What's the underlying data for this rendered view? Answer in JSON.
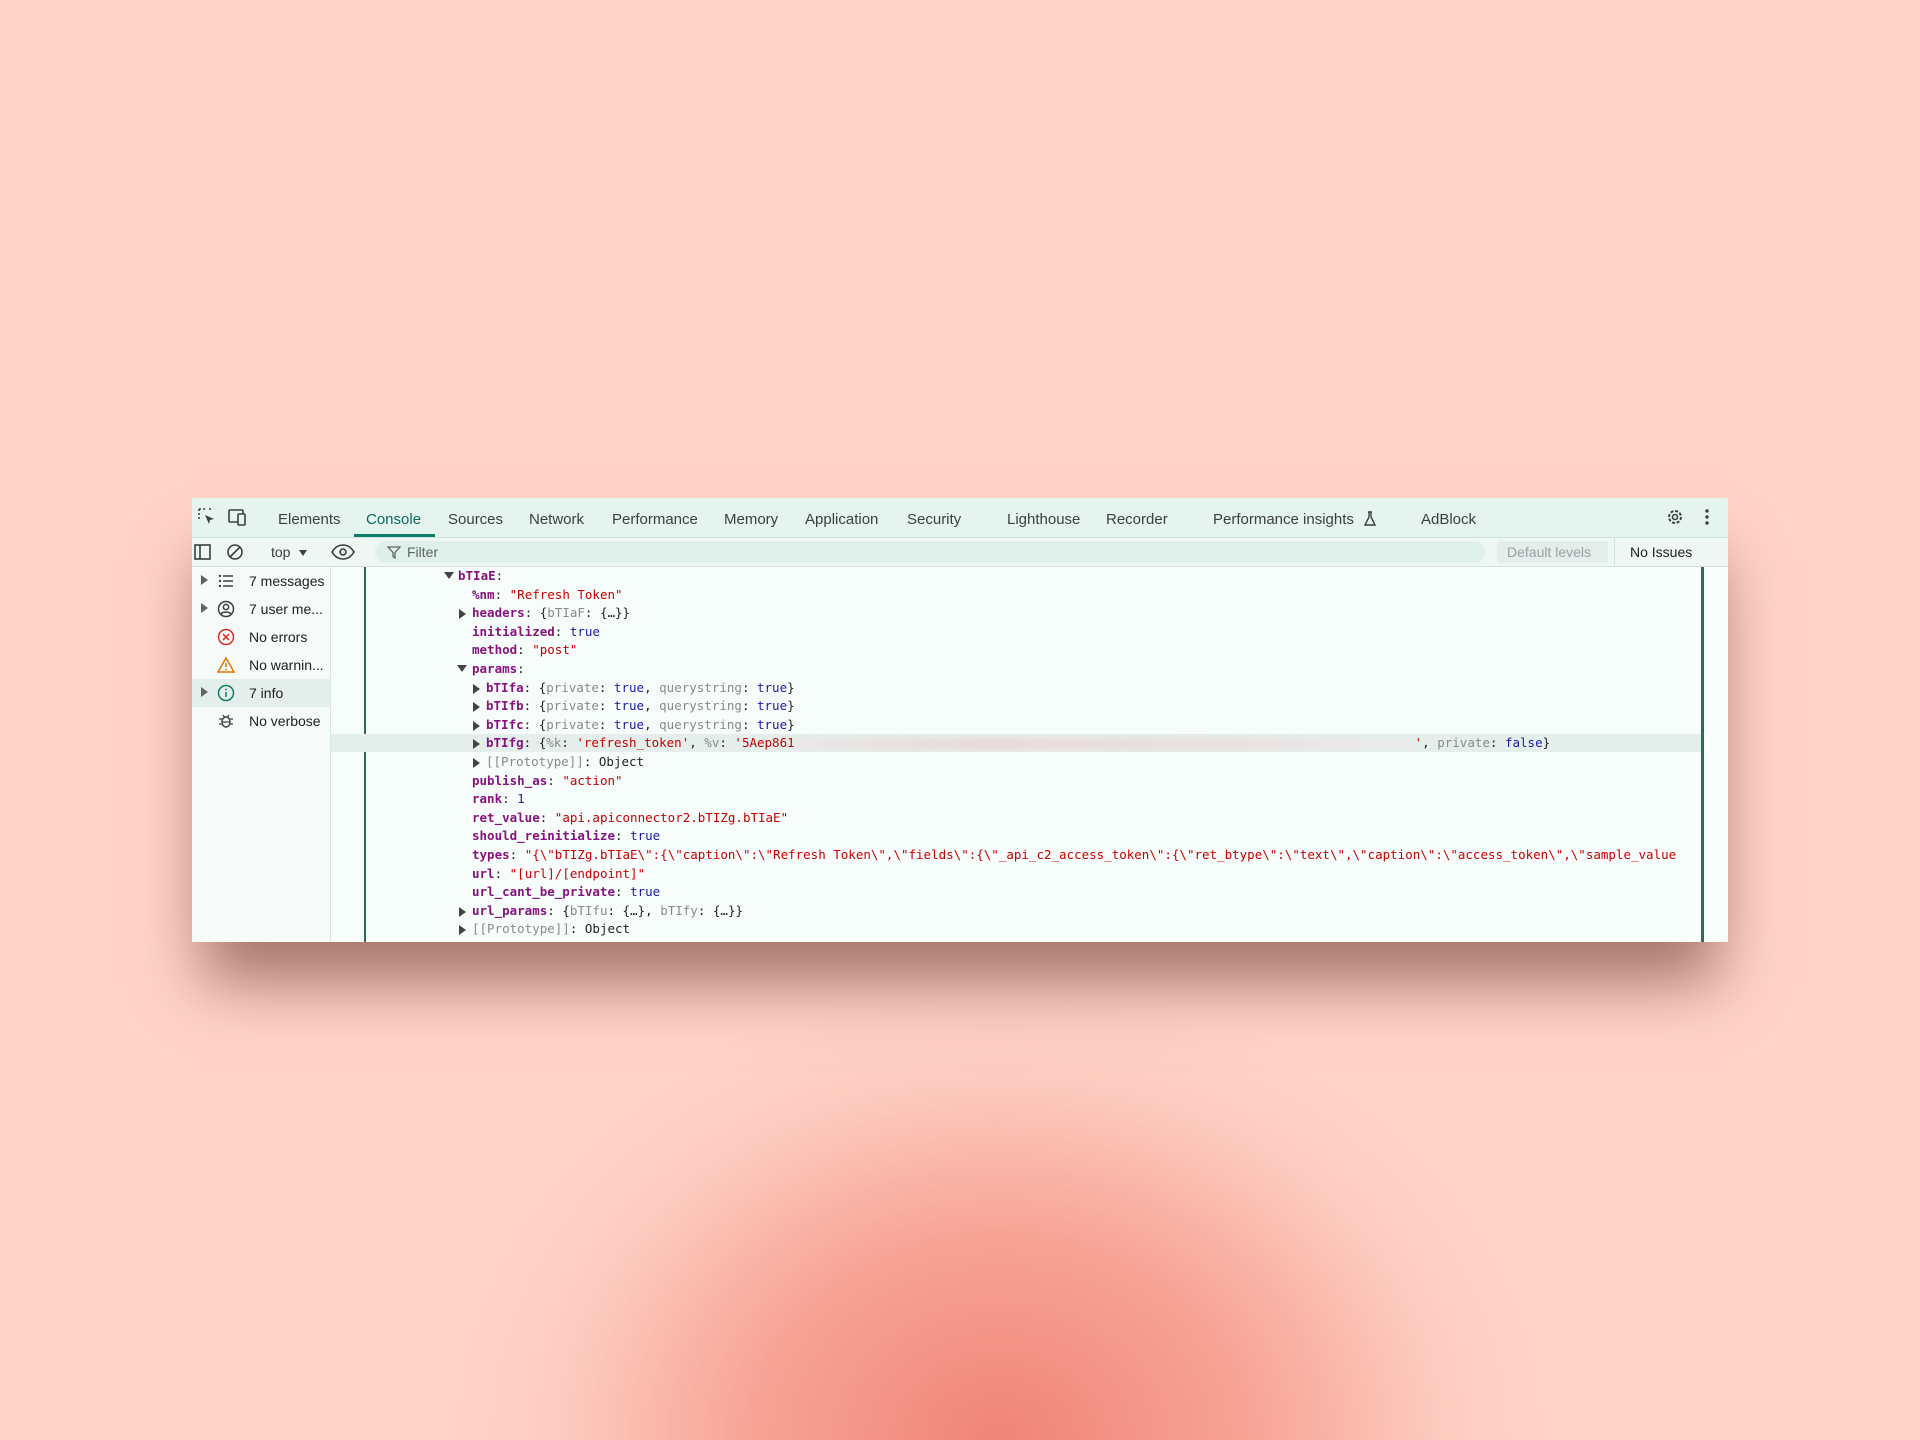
{
  "toolbar": {
    "tabs": [
      {
        "label": "Elements"
      },
      {
        "label": "Console"
      },
      {
        "label": "Sources"
      },
      {
        "label": "Network"
      },
      {
        "label": "Performance"
      },
      {
        "label": "Memory"
      },
      {
        "label": "Application"
      },
      {
        "label": "Security"
      },
      {
        "label": "Lighthouse"
      },
      {
        "label": "Recorder"
      },
      {
        "label": "Performance insights"
      },
      {
        "label": "AdBlock"
      }
    ],
    "active_tab": "Console"
  },
  "console_toolbar": {
    "context": "top",
    "filter_placeholder": "Filter",
    "levels": "Default levels",
    "issues": "No Issues"
  },
  "sidebar": {
    "items": [
      {
        "label": "7 messages",
        "icon": "list-icon",
        "expandable": true
      },
      {
        "label": "7 user me...",
        "icon": "user-icon",
        "expandable": true
      },
      {
        "label": "No errors",
        "icon": "error-icon",
        "expandable": false
      },
      {
        "label": "No warnin...",
        "icon": "warning-icon",
        "expandable": false
      },
      {
        "label": "7 info",
        "icon": "info-icon",
        "expandable": true
      },
      {
        "label": "No verbose",
        "icon": "bug-icon",
        "expandable": false
      }
    ]
  },
  "console": {
    "root_key": "bTIaE",
    "nm_key": "%nm",
    "nm_val": "\"Refresh Token\"",
    "headers_key": "headers",
    "headers_sub": "bTIaF",
    "initialized_key": "initialized",
    "initialized_val": "true",
    "method_key": "method",
    "method_val": "\"post\"",
    "params_key": "params",
    "params": [
      {
        "key": "bTIfa"
      },
      {
        "key": "bTIfb"
      },
      {
        "key": "bTIfc"
      }
    ],
    "private_key": "private",
    "querystring_key": "querystring",
    "true_val": "true",
    "false_val": "false",
    "bTIfg_key": "bTIfg",
    "k_key": "%k",
    "k_val": "'refresh_token'",
    "v_key": "%v",
    "v_val_start": "'5Aep861",
    "v_val_end": "'",
    "prototype_label": "[[Prototype]]",
    "prototype_val": "Object",
    "publish_as_key": "publish_as",
    "publish_as_val": "\"action\"",
    "rank_key": "rank",
    "rank_val": "1",
    "ret_value_key": "ret_value",
    "ret_value_val": "\"api.apiconnector2.bTIZg.bTIaE\"",
    "should_reinitialize_key": "should_reinitialize",
    "should_reinitialize_val": "true",
    "types_key": "types",
    "types_val": "\"{\\\"bTIZg.bTIaE\\\":{\\\"caption\\\":\\\"Refresh Token\\\",\\\"fields\\\":{\\\"_api_c2_access_token\\\":{\\\"ret_btype\\\":\\\"text\\\",\\\"caption\\\":\\\"access_token\\\",\\\"sample_value",
    "url_key": "url",
    "url_val": "\"[url]/[endpoint]\"",
    "url_cant_be_private_key": "url_cant_be_private",
    "url_cant_be_private_val": "true",
    "url_params_key": "url_params",
    "url_params_a": "bTIfu",
    "url_params_b": "bTIfy",
    "ellipsis_obj": "{…}"
  },
  "colors": {
    "background": "#ffd4c6",
    "toolbar": "#e6f4f0",
    "accent": "#0b7f6a",
    "key": "#881280",
    "string": "#c80000",
    "boolean": "#1a1aa6"
  }
}
